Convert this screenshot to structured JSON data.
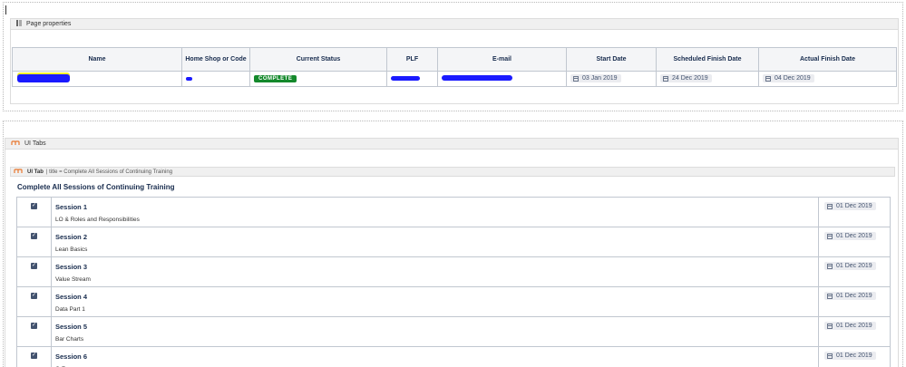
{
  "page_properties": {
    "macro_title": "Page properties",
    "columns": [
      "Name",
      "Home Shop or Code",
      "Current Status",
      "PLF",
      "E-mail",
      "Start Date",
      "Scheduled Finish Date",
      "Actual Finish Date"
    ],
    "row": {
      "status": "COMPLETE",
      "start_date": "03 Jan 2019",
      "scheduled_finish": "24 Dec 2019",
      "actual_finish": "04 Dec 2019"
    },
    "colors": {
      "status": "#14892c",
      "redaction": "#1a1aff"
    }
  },
  "ui_tabs": {
    "macro_title": "UI Tabs",
    "tab_label": "UI Tab",
    "tab_param": "| title = Complete All Sessions of Continuing Training",
    "tab_title": "Complete All Sessions of Continuing Training",
    "tasks": [
      {
        "name": "Session 1",
        "desc": "LO & Roles and Responsibilities",
        "date": "01 Dec 2019",
        "checked": true
      },
      {
        "name": "Session 2",
        "desc": "Lean Basics",
        "date": "01 Dec 2019",
        "checked": true
      },
      {
        "name": "Session 3",
        "desc": "Value Stream",
        "date": "01 Dec 2019",
        "checked": true
      },
      {
        "name": "Session 4",
        "desc": "Data Part 1",
        "date": "01 Dec 2019",
        "checked": true
      },
      {
        "name": "Session 5",
        "desc": "Bar Charts",
        "date": "01 Dec 2019",
        "checked": true
      },
      {
        "name": "Session 6",
        "desc": "C-F",
        "date": "01 Dec 2019",
        "checked": true
      }
    ]
  }
}
